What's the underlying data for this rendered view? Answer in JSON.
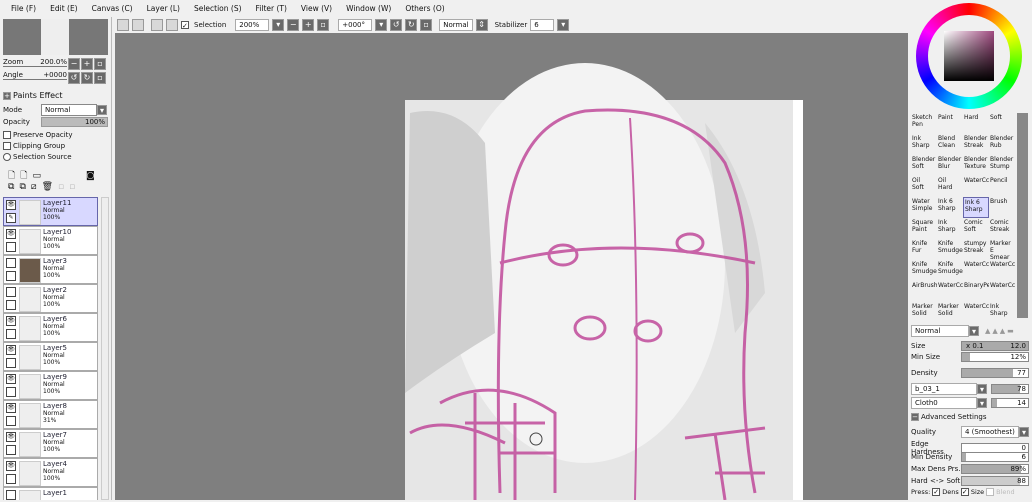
{
  "menu": [
    "File (F)",
    "Edit (E)",
    "Canvas (C)",
    "Layer (L)",
    "Selection (S)",
    "Filter (T)",
    "View (V)",
    "Window (W)",
    "Others (O)"
  ],
  "toolbar": {
    "selection_label": "Selection",
    "zoom": "200%",
    "angle": "+000°",
    "blend": "Normal",
    "stabilizer_label": "Stabilizer",
    "stabilizer": "6"
  },
  "navigator": {
    "zoom_label": "Zoom",
    "zoom": "200.0%",
    "angle_label": "Angle",
    "angle": "+0000"
  },
  "layer_panel": {
    "paints_effect": "Paints Effect",
    "mode_label": "Mode",
    "mode": "Normal",
    "opacity_label": "Opacity",
    "opacity": "100%",
    "opacity_value": 100,
    "preserve_opacity": "Preserve Opacity",
    "clipping_group": "Clipping Group",
    "selection_source": "Selection Source"
  },
  "layers": [
    {
      "name": "Layer11",
      "mode": "Normal",
      "opacity": "100%",
      "visible": true,
      "selected": true
    },
    {
      "name": "Layer10",
      "mode": "Normal",
      "opacity": "100%",
      "visible": true
    },
    {
      "name": "Layer3",
      "mode": "Normal",
      "opacity": "100%",
      "visible": false
    },
    {
      "name": "Layer2",
      "mode": "Normal",
      "opacity": "100%",
      "visible": false
    },
    {
      "name": "Layer6",
      "mode": "Normal",
      "opacity": "100%",
      "visible": true
    },
    {
      "name": "Layer5",
      "mode": "Normal",
      "opacity": "100%",
      "visible": true
    },
    {
      "name": "Layer9",
      "mode": "Normal",
      "opacity": "100%",
      "visible": true
    },
    {
      "name": "Layer8",
      "mode": "Normal",
      "opacity": "31%",
      "visible": true
    },
    {
      "name": "Layer7",
      "mode": "Normal",
      "opacity": "100%",
      "visible": true
    },
    {
      "name": "Layer4",
      "mode": "Normal",
      "opacity": "100%",
      "visible": true
    },
    {
      "name": "Layer1",
      "mode": "",
      "opacity": "",
      "visible": false
    }
  ],
  "brushes": [
    "Sketch\nPen",
    "Paint",
    "Hard",
    "Soft",
    "Ink\nSharp",
    "Blend\nClean",
    "Blender\nStreak",
    "Blender\nRub",
    "Blender\nSoft",
    "Blender\nBlur",
    "Blender\nTexture",
    "Blender\nStump",
    "Oil\nSoft",
    "Oil\nHard",
    "WaterCc",
    "Pencil",
    "Water\nSimple",
    "Ink 6\nSharp",
    "Ink 6\nSharp",
    "Brush",
    "Square\nPaint",
    "Ink\nSharp",
    "Comic\nSoft",
    "Comic\nStreak",
    "Knife\nFur",
    "Knife\nSmudge",
    "stumpy\nStreak",
    "Marker E\nSmear",
    "Knife\nSmudge",
    "Knife\nSmudge",
    "WaterCc",
    "WaterCc",
    "AirBrush",
    "WaterCc",
    "BinaryPe",
    "WaterCc",
    "Marker\nSolid",
    "Marker\nSolid",
    "WaterCc",
    "Ink\nSharp"
  ],
  "selected_brush": 18,
  "brush_settings": {
    "blend": "Normal",
    "size_label": "Size",
    "size_mult": "x 0.1",
    "size": "12.0",
    "min_size_label": "Min Size",
    "min_size": "12%",
    "density_label": "Density",
    "density": "77",
    "texture": "b_03_1",
    "texture_value": "78",
    "texture2": "Cloth0",
    "texture2_value": "14",
    "advanced": "Advanced Settings",
    "quality_label": "Quality",
    "quality": "4 (Smoothest)",
    "edge_label": "Edge Hardness",
    "edge": "0",
    "min_density_label": "Min Density",
    "min_density": "6",
    "max_dens_label": "Max Dens Prs.",
    "max_dens": "89%",
    "hard_soft_label": "Hard <-> Soft",
    "hard_soft": "88",
    "press_label": "Press:",
    "dens": "Dens",
    "size2": "Size",
    "blend2": "Blend"
  },
  "colors": {
    "sketch": "#c04a9a",
    "canvas_bg": "#7f7f7f"
  }
}
